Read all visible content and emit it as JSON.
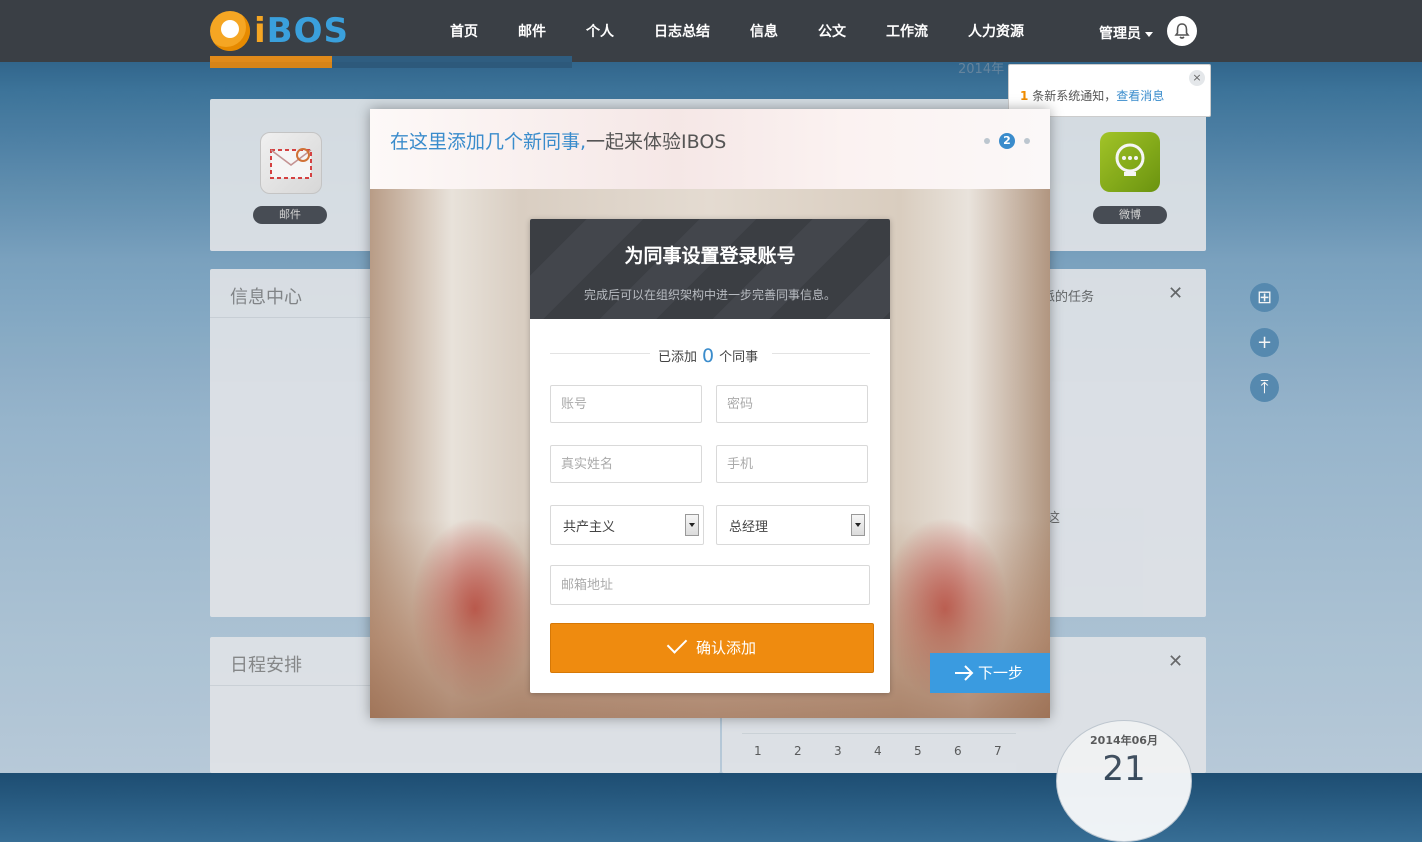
{
  "app": {
    "logo_text_i": "i",
    "logo_text_rest": "BOS"
  },
  "nav": {
    "items": [
      "首页",
      "邮件",
      "个人",
      "日志总结",
      "信息",
      "公文",
      "工作流",
      "人力资源"
    ],
    "user": "管理员"
  },
  "background": {
    "date_strip": "2014年",
    "apps": [
      {
        "label": "邮件",
        "icon": "mail-icon"
      },
      {
        "label": "微博",
        "icon": "lightbulb-chat-icon"
      }
    ],
    "cards": {
      "info_center_title": "信息中心",
      "schedule_title": "日程安排",
      "task_title_fragment": "派的任务",
      "misc_fragment": "这",
      "calendar_month": "2014年06月",
      "calendar_day_fragment": "21",
      "weekday_numbers": [
        "1",
        "2",
        "3",
        "4",
        "5",
        "6",
        "7"
      ]
    }
  },
  "notification": {
    "count": "1",
    "text": "条新系统通知，",
    "link": "查看消息",
    "close": "×"
  },
  "modal": {
    "title_highlight": "在这里添加几个新同事,",
    "title_rest": "一起来体验IBOS",
    "step_active": "2",
    "form": {
      "heading": "为同事设置登录账号",
      "subheading": "完成后可以在组织架构中进一步完善同事信息。",
      "count_prefix": "已添加",
      "count_value": "0",
      "count_suffix": "个同事",
      "placeholders": {
        "account": "账号",
        "password": "密码",
        "realname": "真实姓名",
        "phone": "手机",
        "email": "邮箱地址"
      },
      "department_select": "共产主义",
      "position_select": "总经理",
      "confirm_label": "确认添加"
    },
    "next_label": "下一步"
  },
  "colors": {
    "accent_blue": "#3a8ccc",
    "confirm_orange": "#ef8b0f",
    "topbar": "#3a3f45"
  }
}
